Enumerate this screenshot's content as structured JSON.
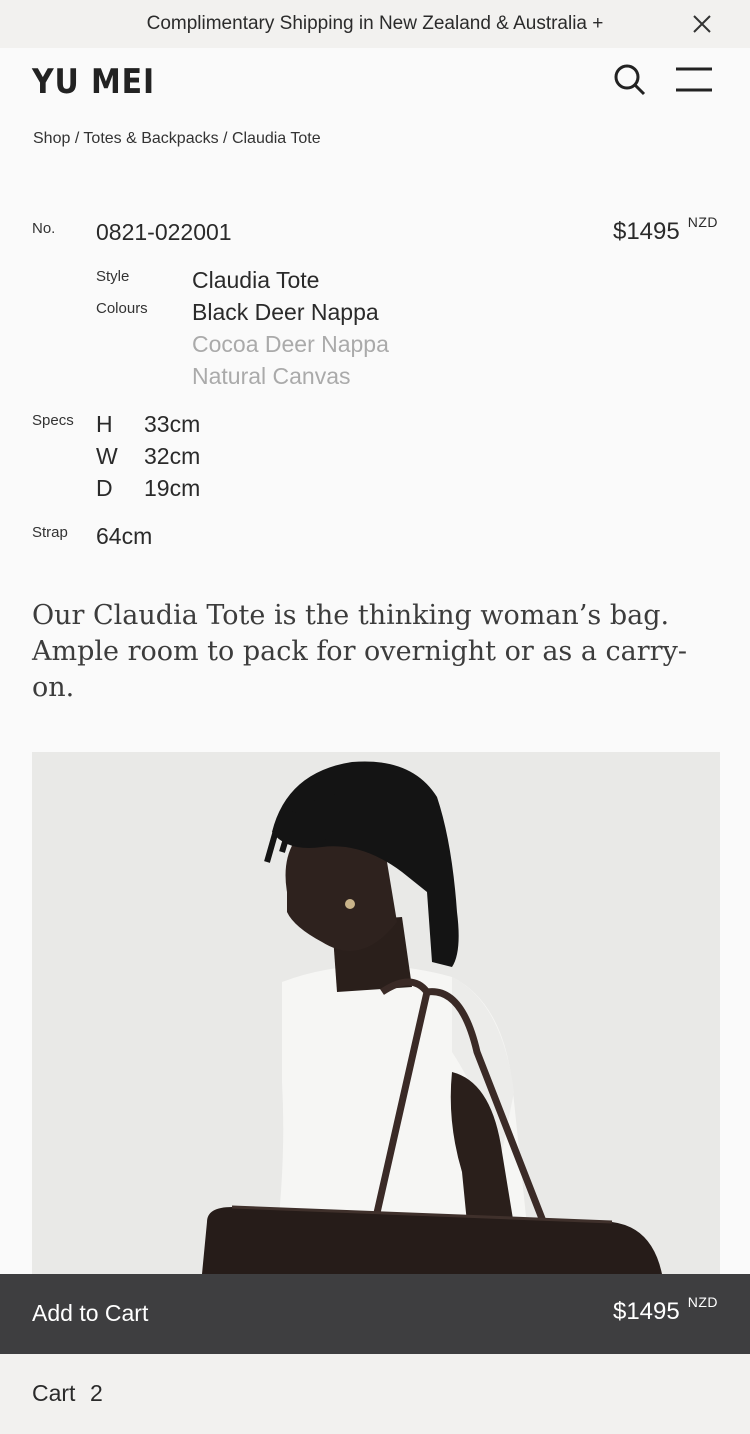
{
  "announcement": {
    "text": "Complimentary Shipping in New Zealand & Australia +",
    "close_icon": "close-icon"
  },
  "header": {
    "logo": "YU MEI",
    "search_icon": "search-icon",
    "menu_icon": "hamburger-menu-icon"
  },
  "breadcrumb": {
    "items": [
      "Shop",
      "Totes & Backpacks",
      "Claudia Tote"
    ],
    "separator": " / "
  },
  "product": {
    "number_label": "No.",
    "number": "0821-022001",
    "price": "$1495",
    "currency": "NZD",
    "style_label": "Style",
    "style": "Claudia Tote",
    "colours_label": "Colours",
    "colours": [
      "Black Deer Nappa",
      "Cocoa Deer Nappa",
      "Natural Canvas"
    ],
    "selected_colour": "Black Deer Nappa",
    "specs_label": "Specs",
    "specs": [
      {
        "dim": "H",
        "value": "33cm"
      },
      {
        "dim": "W",
        "value": "32cm"
      },
      {
        "dim": "D",
        "value": "19cm"
      }
    ],
    "strap_label": "Strap",
    "strap": "64cm",
    "description": "Our Claudia Tote is the thinking woman’s bag. Ample room to pack for overnight or as a carry-on."
  },
  "cart_bar": {
    "label": "Add to Cart",
    "price": "$1495",
    "currency": "NZD"
  },
  "cart_footer": {
    "label": "Cart",
    "count": "2"
  },
  "colors": {
    "background": "#fafafa",
    "announcement_bg": "#f2f1ef",
    "cart_bar_bg": "#3e3e40",
    "muted_text": "#aaaaaa"
  }
}
